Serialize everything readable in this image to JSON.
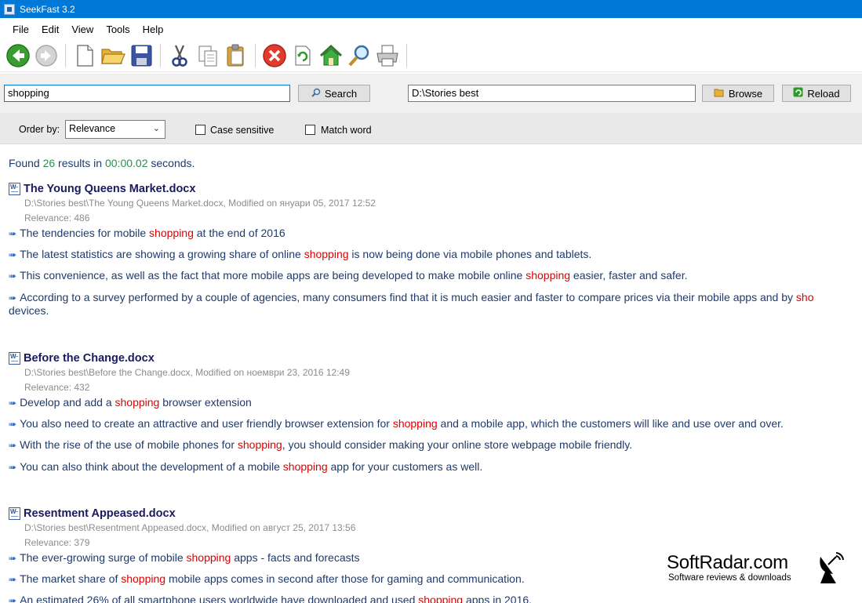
{
  "window": {
    "title": "SeekFast 3.2"
  },
  "menu": [
    "File",
    "Edit",
    "View",
    "Tools",
    "Help"
  ],
  "toolbar": {
    "icons": [
      "back-icon",
      "forward-icon",
      "new-document-icon",
      "open-folder-icon",
      "save-icon",
      "cut-icon",
      "copy-icon",
      "paste-icon",
      "stop-icon",
      "refresh-icon",
      "home-icon",
      "find-icon",
      "print-icon"
    ]
  },
  "search": {
    "query": "shopping",
    "search_label": "Search",
    "folder": "D:\\Stories best",
    "browse_label": "Browse",
    "reload_label": "Reload"
  },
  "options": {
    "order_label": "Order by:",
    "order_value": "Relevance",
    "case_label": "Case sensitive",
    "match_label": "Match word"
  },
  "summary": {
    "prefix": "Found ",
    "count": "26",
    "middle": " results in ",
    "time": "00:00.02",
    "suffix": " seconds."
  },
  "results": [
    {
      "title": "The Young Queens Market.docx",
      "path": "D:\\Stories best\\The Young Queens Market.docx, Modified on януари 05, 2017 12:52",
      "relevance": "Relevance: 486",
      "lines": [
        [
          "The tendencies for mobile ",
          "shopping",
          " at the end of 2016"
        ],
        [
          "The latest statistics are showing a growing share of online ",
          "shopping",
          " is now being done via mobile phones and tablets."
        ],
        [
          "This convenience, as well as the fact that more mobile apps are being developed to make mobile online ",
          "shopping",
          " easier, faster and safer."
        ],
        [
          "According to a survey performed by a couple of agencies, many consumers find that it is much easier and faster to compare prices via their mobile apps and by ",
          "sho",
          ""
        ]
      ],
      "continuation": "devices."
    },
    {
      "title": "Before the Change.docx",
      "path": "D:\\Stories best\\Before the Change.docx, Modified on ноември 23, 2016 12:49",
      "relevance": "Relevance: 432",
      "lines": [
        [
          "Develop and add a ",
          "shopping",
          " browser extension"
        ],
        [
          "You also need to create an attractive and user friendly browser extension for ",
          "shopping",
          " and a mobile app, which the customers will like and use over and over."
        ],
        [
          "With the rise of the use of mobile phones for ",
          "shopping",
          ", you should consider making your online store webpage mobile friendly."
        ],
        [
          "You can also think about the development of a mobile ",
          "shopping",
          " app for your customers as well."
        ]
      ]
    },
    {
      "title": "Resentment Appeased.docx",
      "path": "D:\\Stories best\\Resentment Appeased.docx, Modified on август 25, 2017 13:56",
      "relevance": "Relevance: 379",
      "lines": [
        [
          "The ever-growing surge of mobile ",
          "shopping",
          " apps - facts and forecasts"
        ],
        [
          "The market share of ",
          "shopping",
          " mobile apps comes in second after those for gaming and communication."
        ],
        [
          "An estimated 26% of all smartphone users worldwide have downloaded and used ",
          "shopping",
          " apps in 2016."
        ]
      ]
    }
  ],
  "watermark": {
    "brand": "SoftRadar.com",
    "tagline": "Software reviews & downloads"
  }
}
